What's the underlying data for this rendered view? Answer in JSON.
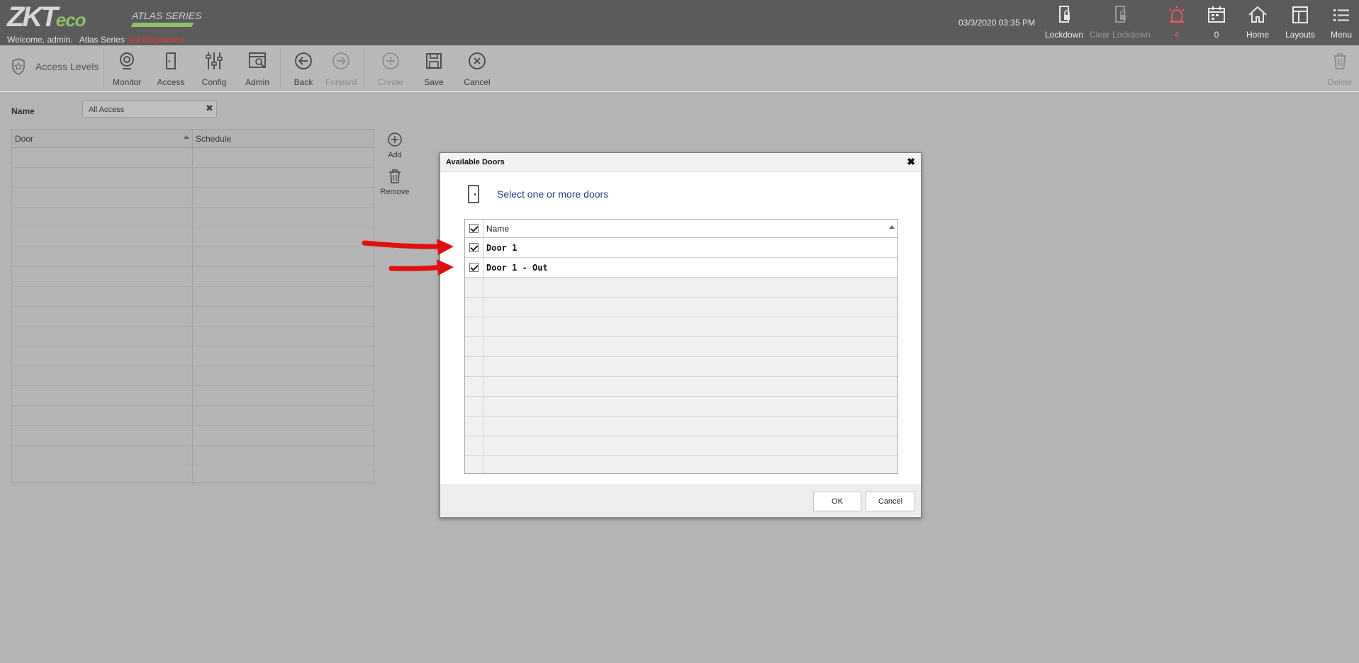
{
  "header": {
    "logo_main": "ZKT",
    "logo_eco": "eco",
    "series_badge": "ATLAS SERIES",
    "welcome_text": "Welcome, admin.",
    "product_text": "Atlas Series",
    "registration_status": "Not Registered",
    "datetime": "03/3/2020 03:35 PM",
    "buttons": [
      {
        "label": "Lockdown",
        "icon": "lock-door-icon"
      },
      {
        "label": "Clear Lockdown",
        "icon": "unlock-door-icon",
        "disabled": true
      },
      {
        "label": "4",
        "icon": "alarm-icon"
      },
      {
        "label": "0",
        "icon": "calendar-icon"
      },
      {
        "label": "Home",
        "icon": "home-icon"
      },
      {
        "label": "Layouts",
        "icon": "layout-icon"
      },
      {
        "label": "Menu",
        "icon": "menu-icon"
      }
    ]
  },
  "toolbar": {
    "breadcrumb": "Access Levels",
    "buttons": [
      {
        "label": "Monitor",
        "icon": "monitor-icon"
      },
      {
        "label": "Access",
        "icon": "door-icon"
      },
      {
        "label": "Config",
        "icon": "sliders-icon"
      },
      {
        "label": "Admin",
        "icon": "admin-icon"
      },
      {
        "label": "Back",
        "icon": "back-arrow-icon"
      },
      {
        "label": "Forward",
        "icon": "forward-arrow-icon",
        "disabled": true
      },
      {
        "label": "Create",
        "icon": "plus-icon",
        "disabled": true
      },
      {
        "label": "Save",
        "icon": "save-icon"
      },
      {
        "label": "Cancel",
        "icon": "cancel-icon"
      },
      {
        "label": "Delete",
        "icon": "trash-icon",
        "disabled": true
      }
    ]
  },
  "form": {
    "name_label": "Name",
    "name_value": "All Access"
  },
  "levels_grid": {
    "columns": [
      "Door",
      "Schedule"
    ],
    "rows": []
  },
  "side_actions": {
    "add_label": "Add",
    "remove_label": "Remove"
  },
  "dialog": {
    "title": "Available Doors",
    "instruction": "Select one or more doors",
    "column_name": "Name",
    "doors": [
      {
        "name": "Door 1",
        "checked": true
      },
      {
        "name": "Door 1 - Out",
        "checked": true
      }
    ],
    "ok_label": "OK",
    "cancel_label": "Cancel"
  },
  "colors": {
    "topbar": "#5b5b5b",
    "toolbar": "#b8b8b8",
    "accent_green": "#8fbf6a",
    "alert_red": "#e53935",
    "annotation_arrow": "#e01010",
    "link_blue": "#1e3f8a"
  }
}
